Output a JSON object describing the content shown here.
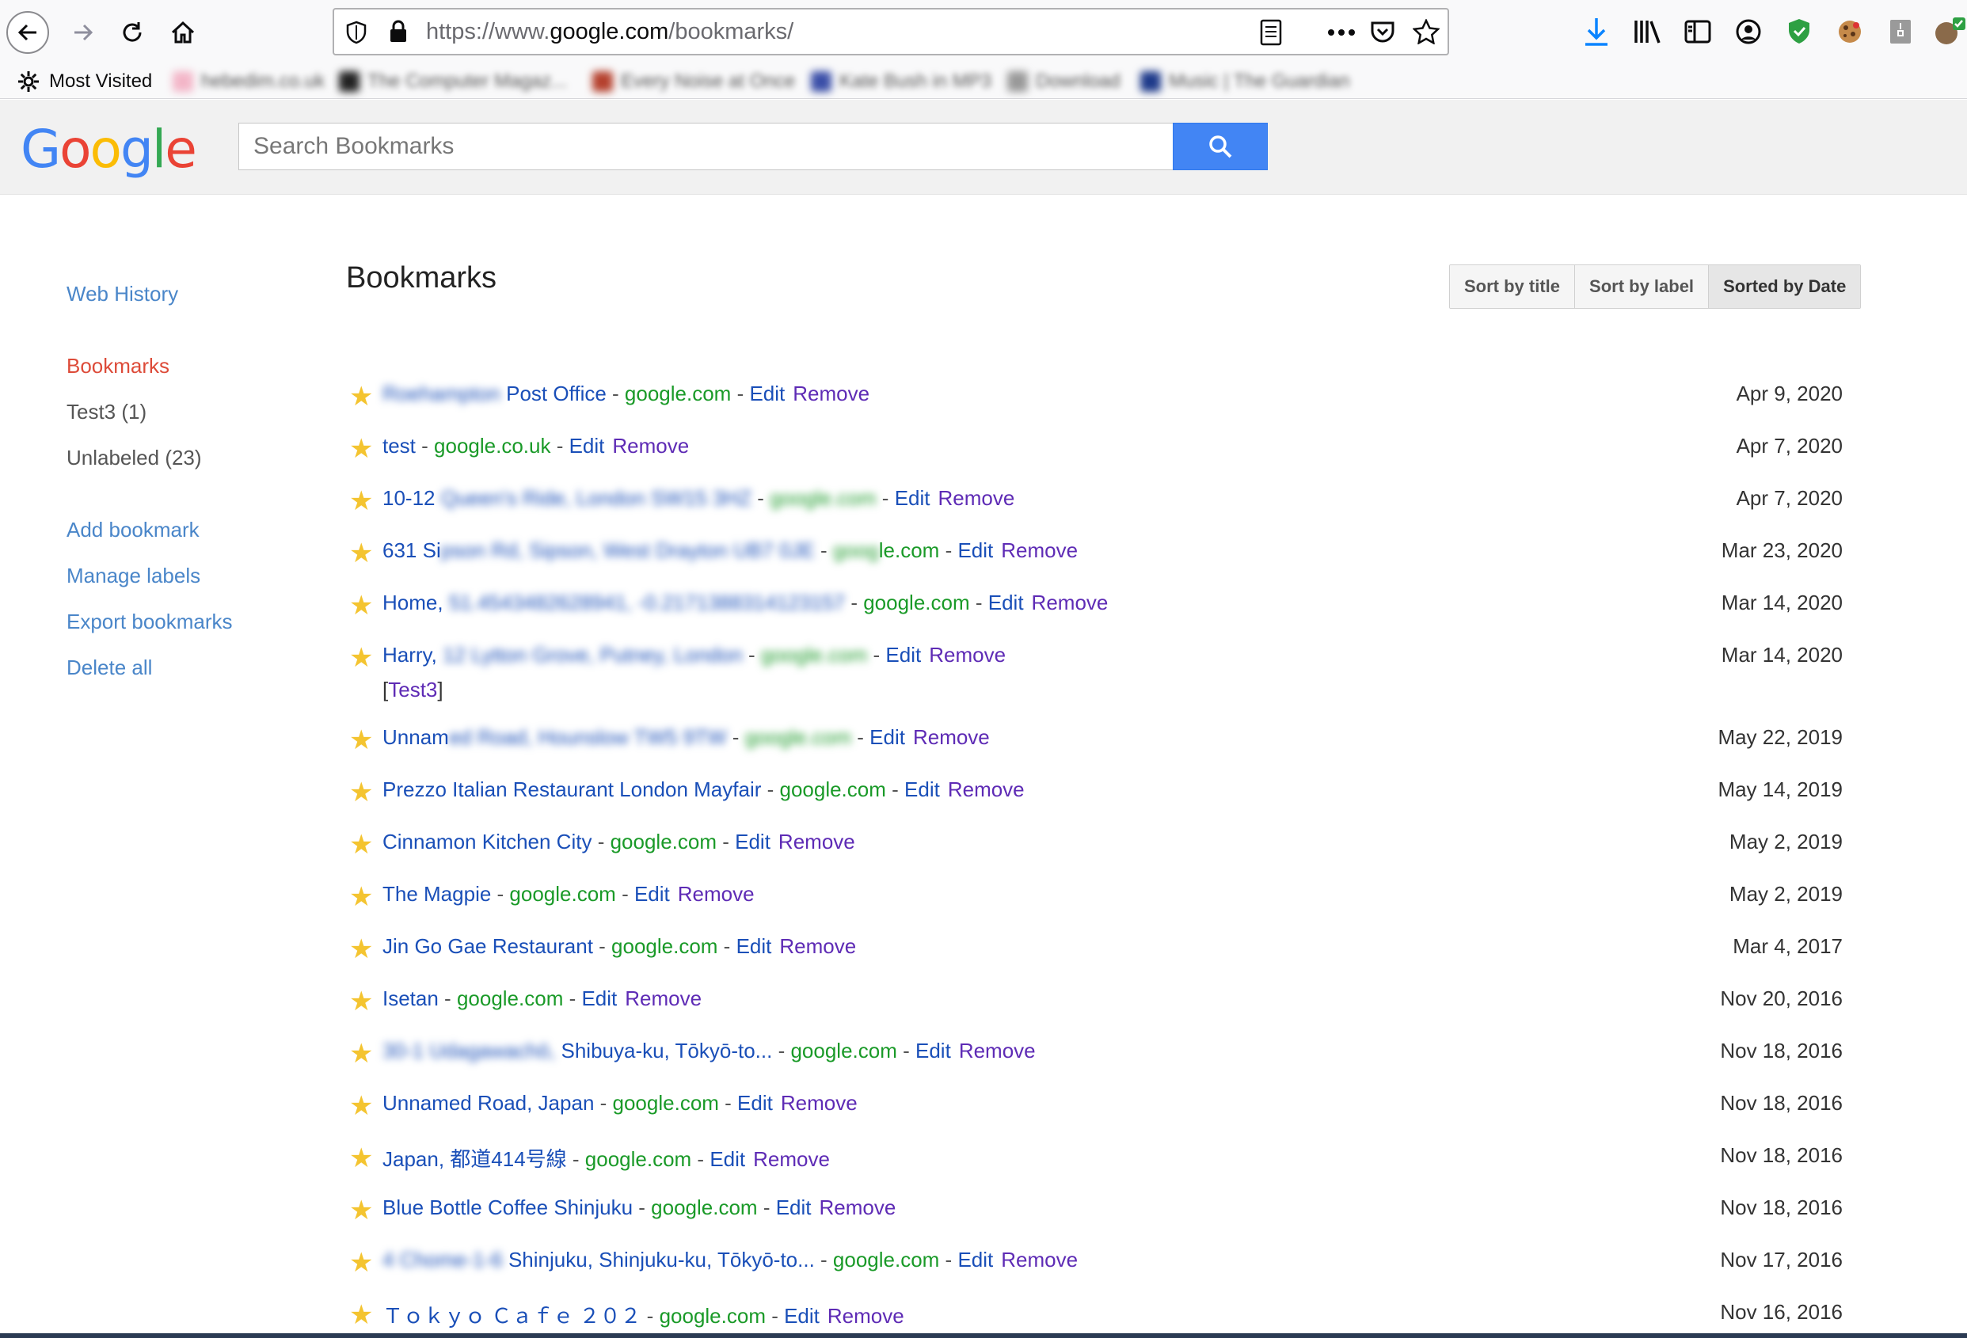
{
  "browser": {
    "url_prefix": "https://www.",
    "url_host": "google.com",
    "url_path": "/bookmarks/",
    "bookmarks_toolbar": {
      "most_visited": "Most Visited",
      "items": [
        "hebedim.co.uk",
        "The Computer Magaz...",
        "Every Noise at Once",
        "Kate Bush in MP3",
        "Download",
        "Music | The Guardian"
      ]
    }
  },
  "header": {
    "logo": "Google",
    "search_placeholder": "Search Bookmarks"
  },
  "sidebar": {
    "web_history": "Web History",
    "bookmarks": "Bookmarks",
    "test3": "Test3 (1)",
    "unlabeled": "Unlabeled (23)",
    "add_bookmark": "Add bookmark",
    "manage_labels": "Manage labels",
    "export_bookmarks": "Export bookmarks",
    "delete_all": "Delete all"
  },
  "main": {
    "title": "Bookmarks",
    "sort_by_title": "Sort by title",
    "sort_by_label": "Sort by label",
    "sorted_by_date": "Sorted by Date",
    "edit_label": "Edit",
    "remove_label": "Remove",
    "sep": " - ",
    "bookmarks": [
      {
        "title_blur": "Roehampton",
        "title": " Post Office",
        "domain": "google.com",
        "date": "Apr 9, 2020"
      },
      {
        "title": "test",
        "domain": "google.co.uk",
        "date": "Apr 7, 2020"
      },
      {
        "title": "10-12 ",
        "title_blur": "Queen's Ride, London SW15 3HZ",
        "domain_blur": "google.com",
        "date": "Apr 7, 2020"
      },
      {
        "title": "631 Si",
        "title_blur": "pson Rd, Sipson, West Drayton UB7 0JE",
        "domain_partial": "le.com",
        "domain_blur": "goog",
        "date": "Mar 23, 2020"
      },
      {
        "title": "Home, ",
        "title_blur": "51.4543482628941, -0.2171388314123157",
        "domain": "google.com",
        "date": "Mar 14, 2020"
      },
      {
        "title": "Harry, ",
        "title_blur": "12 Lytton Grove, Putney, London",
        "domain_blur": "google.com",
        "date": "Mar 14, 2020",
        "label": "Test3"
      },
      {
        "title": "Unnam",
        "title_blur": "ed Road, Hounslow TW5 9TW",
        "domain_blur": "google.com",
        "edit_partial": "Edit",
        "date": "May 22, 2019"
      },
      {
        "title": "Prezzo Italian Restaurant London Mayfair",
        "domain": "google.com",
        "date": "May 14, 2019"
      },
      {
        "title": "Cinnamon Kitchen City",
        "domain": "google.com",
        "date": "May 2, 2019"
      },
      {
        "title": "The Magpie",
        "domain": "google.com",
        "date": "May 2, 2019"
      },
      {
        "title": "Jin Go Gae Restaurant",
        "domain": "google.com",
        "date": "Mar 4, 2017"
      },
      {
        "title": "Isetan",
        "domain": "google.com",
        "date": "Nov 20, 2016"
      },
      {
        "title_blur": "30-1 Udagawachō, ",
        "title": "Shibuya-ku, Tōkyō-to...",
        "domain": "google.com",
        "date": "Nov 18, 2016"
      },
      {
        "title": "Unnamed Road, Japan",
        "domain": "google.com",
        "date": "Nov 18, 2016"
      },
      {
        "title": "Japan, 都道414号線",
        "domain": "google.com",
        "date": "Nov 18, 2016"
      },
      {
        "title": "Blue Bottle Coffee Shinjuku",
        "domain": "google.com",
        "date": "Nov 18, 2016"
      },
      {
        "title_blur": "4 Chome-1-6 ",
        "title": "Shinjuku, Shinjuku-ku, Tōkyō-to...",
        "domain": "google.com",
        "date": "Nov 17, 2016"
      },
      {
        "title": "Ｔｏｋｙｏ Ｃａｆｅ ２０２",
        "domain": "google.com",
        "date": "Nov 16, 2016"
      }
    ]
  }
}
